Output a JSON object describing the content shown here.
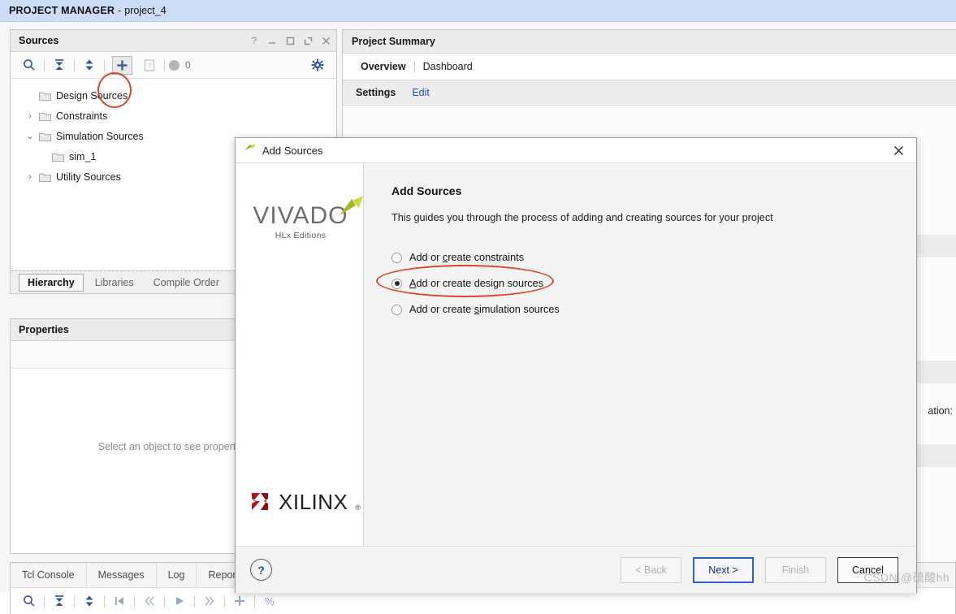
{
  "titlebar": {
    "mode": "PROJECT MANAGER",
    "separator": "-",
    "project": "project_4"
  },
  "sources_panel": {
    "title": "Sources",
    "controls": [
      {
        "name": "help-icon",
        "glyph": "?"
      },
      {
        "name": "minimize-icon",
        "glyph": "—"
      },
      {
        "name": "maximize-icon",
        "glyph": "□"
      },
      {
        "name": "float-icon",
        "glyph": "⇱"
      },
      {
        "name": "close-icon",
        "glyph": "✕"
      }
    ],
    "toolbar": {
      "search": "search-icon",
      "collapse_all": "collapse-all-icon",
      "expand_sort": "sort-icon",
      "add_sources": "plus-icon",
      "report": "report-icon",
      "badge_count": "0",
      "settings": "gear-icon"
    },
    "tree": [
      {
        "label": "Design Sources",
        "arrow": "",
        "indent": false
      },
      {
        "label": "Constraints",
        "arrow": "›",
        "indent": false
      },
      {
        "label": "Simulation Sources",
        "arrow": "⌄",
        "indent": false
      },
      {
        "label": "sim_1",
        "arrow": "",
        "indent": true
      },
      {
        "label": "Utility Sources",
        "arrow": "›",
        "indent": false
      }
    ],
    "tabs": [
      {
        "label": "Hierarchy",
        "active": true
      },
      {
        "label": "Libraries",
        "active": false
      },
      {
        "label": "Compile Order",
        "active": false
      }
    ]
  },
  "properties_panel": {
    "title": "Properties",
    "empty_text": "Select an object to see properties",
    "controls": [
      {
        "name": "help-icon",
        "glyph": "?"
      },
      {
        "name": "minimize-icon",
        "glyph": "—"
      }
    ]
  },
  "project_summary": {
    "title": "Project Summary",
    "tabs": [
      {
        "label": "Overview",
        "active": true
      },
      {
        "label": "Dashboard",
        "active": false
      }
    ],
    "settings_label": "Settings",
    "edit_link": "Edit",
    "right_fragment": "ation:"
  },
  "console": {
    "tabs": [
      "Tcl Console",
      "Messages",
      "Log",
      "Reports"
    ],
    "toolbar_icons": [
      "search-icon",
      "collapse-all-icon",
      "sort-icon",
      "first-icon",
      "previous-icon",
      "play-icon",
      "next-icon",
      "plus-icon",
      "percent-icon"
    ]
  },
  "dialog": {
    "window_title": "Add Sources",
    "close_glyph": "✕",
    "logo": {
      "vivado_word": "VIVADO",
      "vivado_sub": "HLx Editions",
      "xilinx_word": "XILINX"
    },
    "heading": "Add Sources",
    "description": "This guides you through the process of adding and creating sources for your project",
    "options": [
      {
        "prefix": "Add or ",
        "mnemonic": "c",
        "suffix": "reate constraints",
        "selected": false,
        "name": "radio-add-constraints"
      },
      {
        "prefix": "",
        "mnemonic": "A",
        "suffix": "dd or create design sources",
        "selected": true,
        "name": "radio-add-design-sources"
      },
      {
        "prefix": "Add or create ",
        "mnemonic": "s",
        "suffix": "imulation sources",
        "selected": false,
        "name": "radio-add-simulation-sources"
      }
    ],
    "buttons": {
      "help": "?",
      "back": "< Back",
      "next": "Next >",
      "finish": "Finish",
      "cancel": "Cancel"
    }
  },
  "watermark": "CSDN @硫酸hh",
  "colors": {
    "titlebar_bg": "#cddcf7",
    "accent_blue": "#3a5693",
    "link_blue": "#1a51c4",
    "annotation_red": "#d8472b",
    "focus_blue": "#2f5fc7",
    "xilinx_red": "#b01722",
    "vivado_green": "#c3d42f"
  }
}
